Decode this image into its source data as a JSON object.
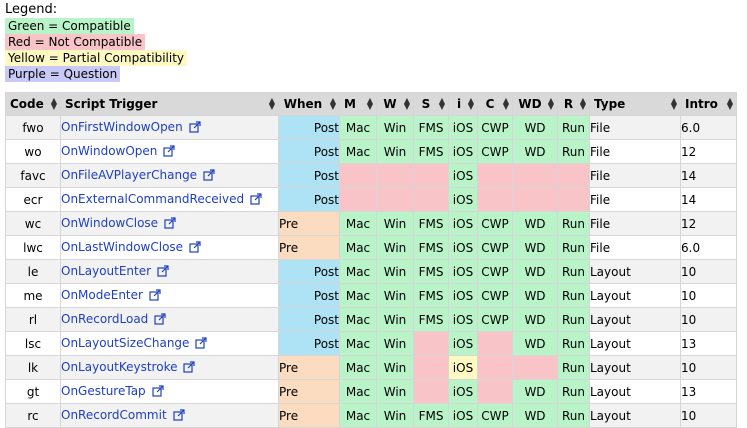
{
  "legend": {
    "title": "Legend:",
    "items": [
      {
        "text": "Green = Compatible",
        "cls": "g"
      },
      {
        "text": "Red = Not Compatible",
        "cls": "r"
      },
      {
        "text": "Yellow = Partial Compatibility",
        "cls": "y"
      },
      {
        "text": "Purple = Question",
        "cls": "p"
      }
    ]
  },
  "colors": {
    "compatible": "#b8f4c8",
    "not_compatible": "#f8c4c8",
    "partial": "#fdf9c0",
    "question": "#c9c9f7",
    "post": "#aee3f5",
    "pre": "#fbdcc0",
    "header": "#d9d9d9",
    "link": "#1f3fbf"
  },
  "table": {
    "headers": {
      "code": "Code",
      "trigger": "Script Trigger",
      "when": "When",
      "m": "M",
      "w": "W",
      "s": "S",
      "i": "i",
      "c": "C",
      "wd": "WD",
      "r": "R",
      "type": "Type",
      "intro": "Intro"
    },
    "rows": [
      {
        "code": "fwo",
        "trigger": "OnFirstWindowOpen",
        "when": "Post",
        "m": "Mac",
        "w": "Win",
        "s": "FMS",
        "i": "iOS",
        "c": "CWP",
        "wd": "WD",
        "r": "Run",
        "compat": [
          "g",
          "g",
          "g",
          "g",
          "g",
          "g",
          "g"
        ],
        "type": "File",
        "intro": "6.0"
      },
      {
        "code": "wo",
        "trigger": "OnWindowOpen",
        "when": "Post",
        "m": "Mac",
        "w": "Win",
        "s": "FMS",
        "i": "iOS",
        "c": "CWP",
        "wd": "WD",
        "r": "Run",
        "compat": [
          "g",
          "g",
          "g",
          "g",
          "g",
          "g",
          "g"
        ],
        "type": "File",
        "intro": "12"
      },
      {
        "code": "favc",
        "trigger": "OnFileAVPlayerChange",
        "when": "Post",
        "m": "",
        "w": "",
        "s": "",
        "i": "iOS",
        "c": "",
        "wd": "",
        "r": "",
        "compat": [
          "r",
          "r",
          "r",
          "g",
          "r",
          "r",
          "r"
        ],
        "type": "File",
        "intro": "14"
      },
      {
        "code": "ecr",
        "trigger": "OnExternalCommandReceived",
        "when": "Post",
        "m": "",
        "w": "",
        "s": "",
        "i": "iOS",
        "c": "",
        "wd": "",
        "r": "",
        "compat": [
          "r",
          "r",
          "r",
          "g",
          "r",
          "r",
          "r"
        ],
        "type": "File",
        "intro": "14"
      },
      {
        "code": "wc",
        "trigger": "OnWindowClose",
        "when": "Pre",
        "m": "Mac",
        "w": "Win",
        "s": "FMS",
        "i": "iOS",
        "c": "CWP",
        "wd": "WD",
        "r": "Run",
        "compat": [
          "g",
          "g",
          "g",
          "g",
          "g",
          "g",
          "g"
        ],
        "type": "File",
        "intro": "12"
      },
      {
        "code": "lwc",
        "trigger": "OnLastWindowClose",
        "when": "Pre",
        "m": "Mac",
        "w": "Win",
        "s": "FMS",
        "i": "iOS",
        "c": "CWP",
        "wd": "WD",
        "r": "Run",
        "compat": [
          "g",
          "g",
          "g",
          "g",
          "g",
          "g",
          "g"
        ],
        "type": "File",
        "intro": "6.0"
      },
      {
        "code": "le",
        "trigger": "OnLayoutEnter",
        "when": "Post",
        "m": "Mac",
        "w": "Win",
        "s": "FMS",
        "i": "iOS",
        "c": "CWP",
        "wd": "WD",
        "r": "Run",
        "compat": [
          "g",
          "g",
          "g",
          "g",
          "g",
          "g",
          "g"
        ],
        "type": "Layout",
        "intro": "10"
      },
      {
        "code": "me",
        "trigger": "OnModeEnter",
        "when": "Post",
        "m": "Mac",
        "w": "Win",
        "s": "FMS",
        "i": "iOS",
        "c": "CWP",
        "wd": "WD",
        "r": "Run",
        "compat": [
          "g",
          "g",
          "g",
          "g",
          "g",
          "g",
          "g"
        ],
        "type": "Layout",
        "intro": "10"
      },
      {
        "code": "rl",
        "trigger": "OnRecordLoad",
        "when": "Post",
        "m": "Mac",
        "w": "Win",
        "s": "FMS",
        "i": "iOS",
        "c": "CWP",
        "wd": "WD",
        "r": "Run",
        "compat": [
          "g",
          "g",
          "g",
          "g",
          "g",
          "g",
          "g"
        ],
        "type": "Layout",
        "intro": "10"
      },
      {
        "code": "lsc",
        "trigger": "OnLayoutSizeChange",
        "when": "Post",
        "m": "Mac",
        "w": "Win",
        "s": "",
        "i": "iOS",
        "c": "",
        "wd": "WD",
        "r": "Run",
        "compat": [
          "g",
          "g",
          "r",
          "g",
          "r",
          "g",
          "g"
        ],
        "type": "Layout",
        "intro": "13"
      },
      {
        "code": "lk",
        "trigger": "OnLayoutKeystroke",
        "when": "Pre",
        "m": "Mac",
        "w": "Win",
        "s": "",
        "i": "iOS",
        "c": "",
        "wd": "",
        "r": "Run",
        "compat": [
          "g",
          "g",
          "r",
          "y",
          "r",
          "r",
          "g"
        ],
        "type": "Layout",
        "intro": "10"
      },
      {
        "code": "gt",
        "trigger": "OnGestureTap",
        "when": "Pre",
        "m": "Mac",
        "w": "Win",
        "s": "",
        "i": "iOS",
        "c": "",
        "wd": "WD",
        "r": "Run",
        "compat": [
          "g",
          "g",
          "r",
          "g",
          "r",
          "g",
          "g"
        ],
        "type": "Layout",
        "intro": "13"
      },
      {
        "code": "rc",
        "trigger": "OnRecordCommit",
        "when": "Pre",
        "m": "Mac",
        "w": "Win",
        "s": "FMS",
        "i": "iOS",
        "c": "CWP",
        "wd": "WD",
        "r": "Run",
        "compat": [
          "g",
          "g",
          "g",
          "g",
          "g",
          "g",
          "g"
        ],
        "type": "Layout",
        "intro": "10"
      }
    ]
  }
}
